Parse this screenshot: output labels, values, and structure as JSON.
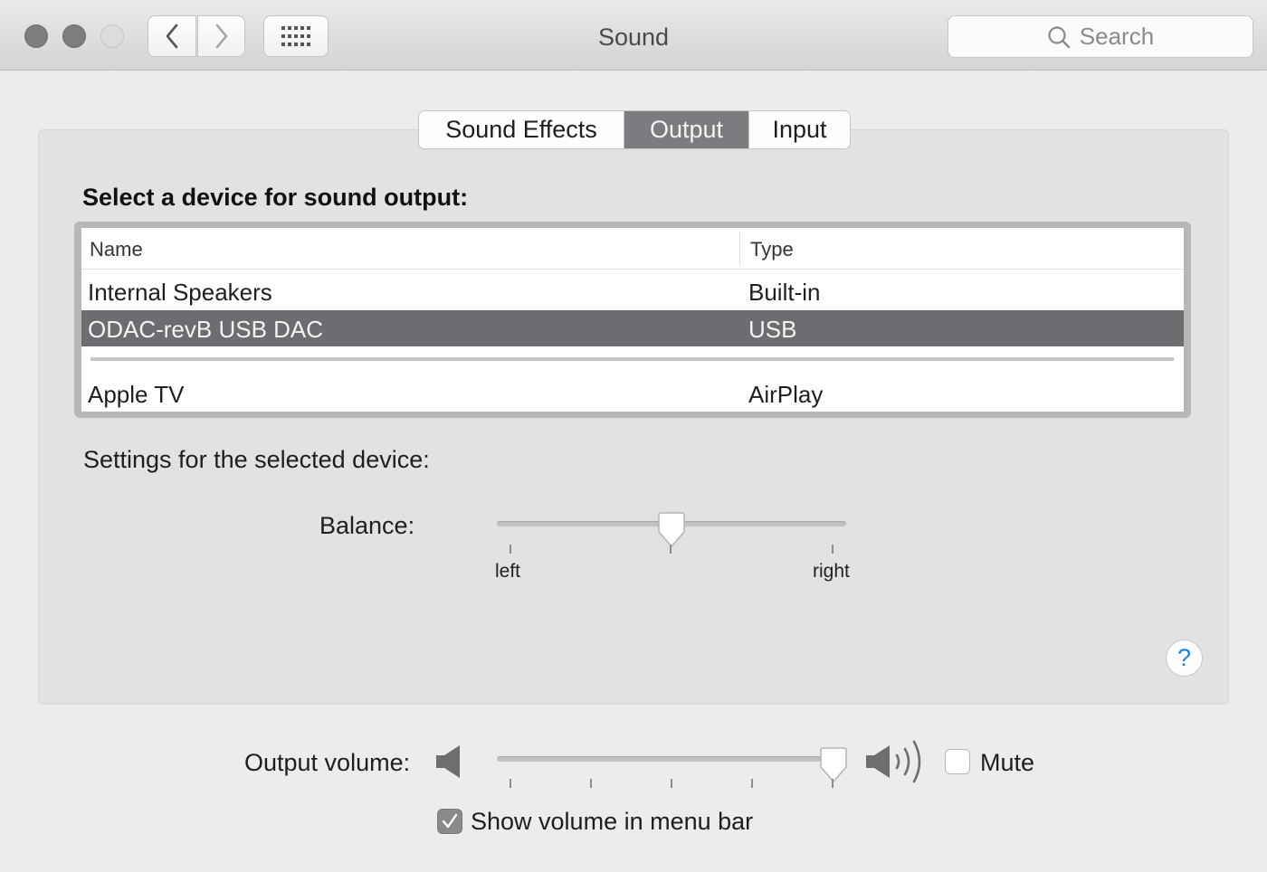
{
  "window": {
    "title": "Sound",
    "search_placeholder": "Search"
  },
  "tabs": [
    {
      "label": "Sound Effects",
      "selected": false
    },
    {
      "label": "Output",
      "selected": true
    },
    {
      "label": "Input",
      "selected": false
    }
  ],
  "output": {
    "section_title": "Select a device for sound output:",
    "columns": {
      "name": "Name",
      "type": "Type"
    },
    "devices": [
      {
        "name": "Internal Speakers",
        "type": "Built-in",
        "selected": false
      },
      {
        "name": "ODAC-revB USB DAC",
        "type": "USB",
        "selected": true
      },
      {
        "name": "Apple TV",
        "type": "AirPlay",
        "selected": false
      }
    ],
    "settings_label": "Settings for the selected device:",
    "balance": {
      "label": "Balance:",
      "min_label": "left",
      "max_label": "right",
      "value": 0.5
    }
  },
  "volume": {
    "label": "Output volume:",
    "value": 1.0,
    "mute_label": "Mute",
    "mute_checked": false,
    "show_in_menubar_label": "Show volume in menu bar",
    "show_in_menubar_checked": true
  },
  "icons": {
    "close": "close-button",
    "minimize": "minimize-button",
    "zoom": "zoom-button",
    "back": "chevron-left-icon",
    "forward": "chevron-right-icon",
    "grid": "grid-icon",
    "search": "search-icon",
    "help": "help-icon",
    "speaker_low": "speaker-low-icon",
    "speaker_high": "speaker-high-icon"
  },
  "colors": {
    "selection": "#6c6c71",
    "accent": "#1a82ea"
  }
}
